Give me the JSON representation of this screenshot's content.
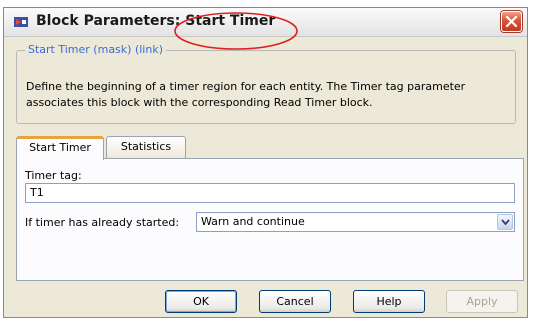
{
  "window": {
    "title": "Block Parameters: Start Timer",
    "title_icon": "simulink-block-icon",
    "close_icon": "close-icon",
    "highlight_color": "#e02020"
  },
  "mask": {
    "legend": "Start Timer (mask) (link)",
    "description": "Define the beginning of a timer region for each entity. The Timer tag parameter associates this block with the corresponding Read Timer block."
  },
  "tabs": [
    {
      "label": "Start Timer",
      "active": true
    },
    {
      "label": "Statistics",
      "active": false
    }
  ],
  "params": {
    "timer_tag_label": "Timer tag:",
    "timer_tag_value": "T1",
    "started_label": "If timer has already started:",
    "started_value": "Warn and continue"
  },
  "buttons": {
    "ok": "OK",
    "cancel": "Cancel",
    "help": "Help",
    "apply": "Apply"
  },
  "colors": {
    "accent_tab": "#e8a43c",
    "link_blue": "#3b6bd6",
    "close_red": "#d9533a"
  }
}
